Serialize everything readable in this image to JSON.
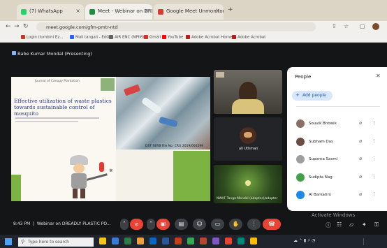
{
  "browser": {
    "tabs": [
      {
        "title": "(7) WhatsApp",
        "favicon_color": "#25d366"
      },
      {
        "title": "Meet - Webinar on DREA",
        "favicon_color": "#1e8e3e",
        "active": true
      },
      {
        "title": "Google Meet Unmonitor sun",
        "favicon_color": "#d23f31"
      }
    ],
    "url": "meet.google.com/gfm-pmtr-ntd",
    "bookmarks": [
      {
        "label": "Login (lumbini Ez...",
        "color": "#c0392b"
      },
      {
        "label": "Mail tangali - EdG",
        "color": "#2962ff"
      },
      {
        "label": "AIR ENC (NPIM)",
        "color": "#616161"
      },
      {
        "label": "Gmail",
        "color": "#d93025"
      },
      {
        "label": "YouTube",
        "color": "#ff0000"
      },
      {
        "label": "Adobe Acrobat Home",
        "color": "#b71c1c"
      },
      {
        "label": "Adobe Acrobat",
        "color": "#b71c1c"
      }
    ]
  },
  "meet": {
    "presenting_label": "Babe Kumar Mondal (Presenting)",
    "slide": {
      "journal_name": "Journal of Canopy Plantation",
      "title_text": "Effective utilization of waste plastics towards sustainable control of mosquito",
      "photo_caption": "DST SERB File No. CRG 2019/004599"
    },
    "tiles": [
      {
        "name": ""
      },
      {
        "name": "ali Uthman"
      },
      {
        "name": "NWAF Tanga Mondal (adopter)/adopter"
      }
    ],
    "people_panel": {
      "title": "People",
      "add_label": "Add people",
      "participants": [
        {
          "name": "Souvik Bhowik",
          "color": "#8d6e63"
        },
        {
          "name": "Subham Das",
          "color": "#6d4c41"
        },
        {
          "name": "Suparna Sasmi",
          "color": "#9e9e9e"
        },
        {
          "name": "Sudipta Nag",
          "color": "#43a047"
        },
        {
          "name": "Al Barkatim",
          "color": "#1e88e5"
        }
      ]
    },
    "clock": "8:43 PM",
    "meeting_title": "Webinar on DREADLY PLASTIC PO...",
    "activate_windows": "Activate Windows"
  },
  "taskbar": {
    "search_placeholder": "Type here to search"
  }
}
